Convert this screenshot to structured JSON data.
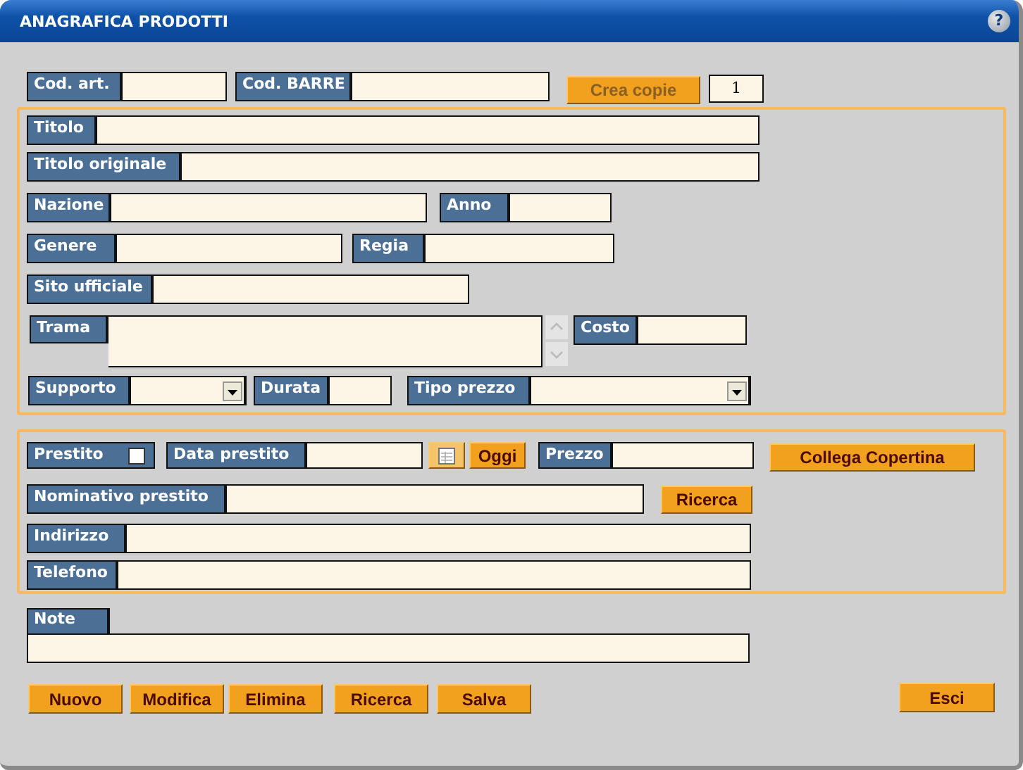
{
  "window": {
    "title": "ANAGRAFICA PRODOTTI",
    "help": "?"
  },
  "header_row": [
    {
      "kind": "field",
      "label": "Cod. art."
    },
    {
      "kind": "field",
      "label": "Cod. BARRE"
    },
    {
      "kind": "button",
      "label": "Crea copie",
      "disabled": true
    },
    {
      "kind": "number_box",
      "value": "1"
    }
  ],
  "product_section": [
    [
      {
        "kind": "field",
        "label": "Titolo"
      }
    ],
    [
      {
        "kind": "field",
        "label": "Titolo originale"
      }
    ],
    [
      {
        "kind": "field",
        "label": "Nazione"
      },
      {
        "kind": "field",
        "label": "Anno"
      }
    ],
    [
      {
        "kind": "field",
        "label": "Genere"
      },
      {
        "kind": "field",
        "label": "Regia"
      }
    ],
    [
      {
        "kind": "field",
        "label": "Sito ufficiale"
      }
    ],
    [
      {
        "kind": "textarea",
        "label": "Trama"
      },
      {
        "kind": "field",
        "label": "Costo"
      }
    ],
    [
      {
        "kind": "dropdown",
        "label": "Supporto"
      },
      {
        "kind": "field",
        "label": "Durata"
      },
      {
        "kind": "dropdown",
        "label": "Tipo prezzo"
      }
    ]
  ],
  "loan_section": [
    [
      {
        "kind": "checkbox_field",
        "label": "Prestito",
        "checked": false
      },
      {
        "kind": "field",
        "label": "Data prestito"
      },
      {
        "kind": "calendar_button"
      },
      {
        "kind": "button",
        "label": "Oggi",
        "disabled": false
      },
      {
        "kind": "field",
        "label": "Prezzo"
      },
      {
        "kind": "button",
        "label": "Collega Copertina",
        "disabled": false
      }
    ],
    [
      {
        "kind": "field",
        "label": "Nominativo prestito"
      },
      {
        "kind": "button",
        "label": "Ricerca",
        "disabled": false
      }
    ],
    [
      {
        "kind": "field",
        "label": "Indirizzo"
      }
    ],
    [
      {
        "kind": "field",
        "label": "Telefono"
      }
    ]
  ],
  "note": {
    "label": "Note"
  },
  "actions": [
    {
      "label": "Nuovo",
      "disabled": false
    },
    {
      "label": "Modifica",
      "disabled": false
    },
    {
      "label": "Elimina",
      "disabled": false
    },
    {
      "label": "Ricerca",
      "disabled": false
    },
    {
      "label": "Salva",
      "disabled": false
    }
  ],
  "exit": {
    "label": "Esci",
    "disabled": false
  }
}
